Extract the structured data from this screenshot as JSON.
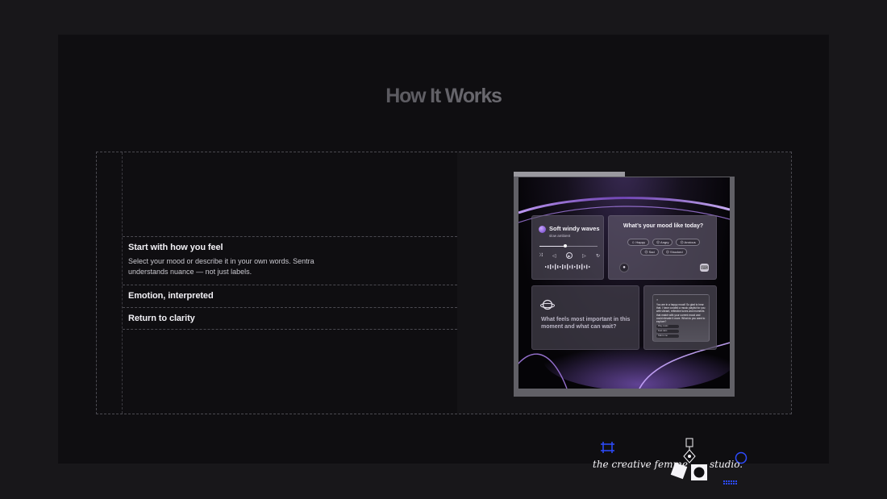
{
  "section_title": "How It Works",
  "steps": [
    {
      "title": "Start with how you feel",
      "description": "Select your mood or describe it in your own words. Sentra understands nuance — not just labels.",
      "expanded": true
    },
    {
      "title": "Emotion, interpreted",
      "expanded": false
    },
    {
      "title": "Return to clarity",
      "expanded": false
    }
  ],
  "mockup": {
    "player": {
      "song_title": "Soft windy waves",
      "song_subtitle": "slow ambient",
      "progress": 0.45
    },
    "mood": {
      "question": "What’s your mood like today?",
      "chips": [
        "Happy",
        "Angry",
        "Anxious",
        "Sad",
        "Shocked"
      ]
    },
    "reflection": {
      "question": "What feels most important in this moment and what can wait?"
    },
    "chat": {
      "close_label": "×",
      "message": "You are in a happy mood! So glad to hear that. I have curated a music playlist for you with vibrant, reflective tunes and moments that match with your current mood and could elevate it more. What do you want to explore?",
      "replies": [
        "Play music",
        "Feel calm",
        "Talk to me"
      ]
    }
  },
  "branding": {
    "studio_left": "the creative femme",
    "studio_right": "studio."
  },
  "colors": {
    "accent_purple": "#7b52d8",
    "logo_blue": "#2d4bff",
    "background": "#0f0e11"
  }
}
